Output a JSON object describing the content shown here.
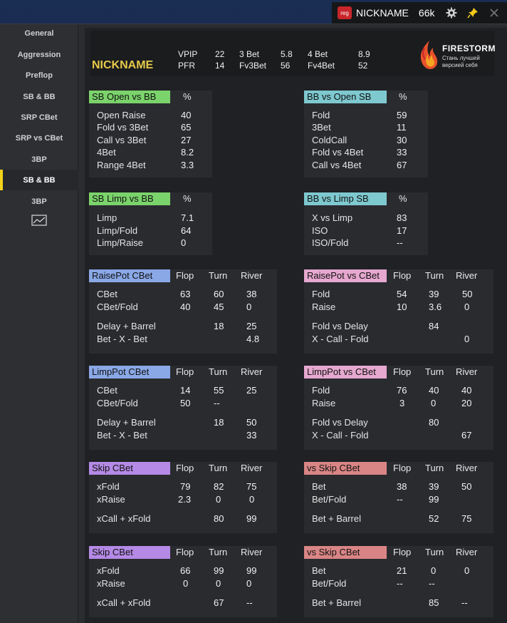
{
  "titlebar": {
    "logo_text": "reg",
    "nickname": "NICKNAME",
    "hands": "66k",
    "icons": [
      "gear-icon",
      "pin-icon",
      "close-icon"
    ]
  },
  "sidebar": {
    "items": [
      {
        "label": "General"
      },
      {
        "label": "Aggression"
      },
      {
        "label": "Preflop"
      },
      {
        "label": "SB & BB"
      },
      {
        "label": "SRP CBet"
      },
      {
        "label": "SRP vs CBet"
      },
      {
        "label": "3BP"
      },
      {
        "label": "SB & BB",
        "active": true
      },
      {
        "label": "3BP"
      }
    ],
    "chart_icon": "chart-icon"
  },
  "header": {
    "nickname": "NICKNAME",
    "stats": [
      {
        "label": "VPIP",
        "value": "22"
      },
      {
        "label": "PFR",
        "value": "14"
      },
      {
        "label": "3 Bet",
        "value": "5.8"
      },
      {
        "label": "Fv3Bet",
        "value": "56"
      },
      {
        "label": "4 Bet",
        "value": "8.9"
      },
      {
        "label": "Fv4Bet",
        "value": "52"
      }
    ],
    "brand_name": "FIRESTORM",
    "brand_tagline": "Стань лучшей версией себя"
  },
  "colors": {
    "green": "#7bd36b",
    "teal": "#7ec8cf",
    "blue": "#8aa8e6",
    "pink": "#e6a8cf",
    "purple": "#b58ae6",
    "red": "#d98585",
    "gold": "#e6c94a"
  },
  "panels": {
    "sb_open": {
      "title": "SB Open vs BB",
      "cols": [
        "%"
      ],
      "rows": [
        {
          "label": "Open Raise",
          "values": [
            "40"
          ]
        },
        {
          "label": "Fold vs 3Bet",
          "values": [
            "65"
          ]
        },
        {
          "label": "Call vs 3Bet",
          "values": [
            "27"
          ]
        },
        {
          "label": "4Bet",
          "values": [
            "8.2"
          ]
        },
        {
          "label": "Range 4Bet",
          "values": [
            "3.3"
          ]
        }
      ]
    },
    "bb_open": {
      "title": "BB vs Open SB",
      "cols": [
        "%"
      ],
      "rows": [
        {
          "label": "Fold",
          "values": [
            "59"
          ]
        },
        {
          "label": "3Bet",
          "values": [
            "11"
          ]
        },
        {
          "label": "ColdCall",
          "values": [
            "30"
          ]
        },
        {
          "label": "Fold vs 4Bet",
          "values": [
            "33"
          ]
        },
        {
          "label": "Call vs 4Bet",
          "values": [
            "67"
          ]
        }
      ]
    },
    "sb_limp": {
      "title": "SB Limp vs BB",
      "cols": [
        "%"
      ],
      "rows": [
        {
          "label": "Limp",
          "values": [
            "7.1"
          ]
        },
        {
          "label": "Limp/Fold",
          "values": [
            "64"
          ]
        },
        {
          "label": "Limp/Raise",
          "values": [
            "0"
          ]
        }
      ]
    },
    "bb_limp": {
      "title": "BB vs Limp SB",
      "cols": [
        "%"
      ],
      "rows": [
        {
          "label": "X vs Limp",
          "values": [
            "83"
          ]
        },
        {
          "label": "ISO",
          "values": [
            "17"
          ]
        },
        {
          "label": "ISO/Fold",
          "values": [
            "--"
          ]
        }
      ]
    },
    "raise_cbet": {
      "title": "RaisePot CBet",
      "cols": [
        "Flop",
        "Turn",
        "River"
      ],
      "rows": [
        {
          "label": "CBet",
          "values": [
            "63",
            "60",
            "38"
          ]
        },
        {
          "label": "CBet/Fold",
          "values": [
            "40",
            "45",
            "0"
          ]
        },
        {
          "label": "Delay + Barrel",
          "values": [
            "",
            "18",
            "25"
          ]
        },
        {
          "label": "Bet - X - Bet",
          "values": [
            "",
            "",
            "4.8"
          ]
        }
      ]
    },
    "raise_vs_cbet": {
      "title": "RaisePot vs CBet",
      "cols": [
        "Flop",
        "Turn",
        "River"
      ],
      "rows": [
        {
          "label": "Fold",
          "values": [
            "54",
            "39",
            "50"
          ]
        },
        {
          "label": "Raise",
          "values": [
            "10",
            "3.6",
            "0"
          ]
        },
        {
          "label": "Fold vs Delay",
          "values": [
            "",
            "84",
            ""
          ]
        },
        {
          "label": "X - Call - Fold",
          "values": [
            "",
            "",
            "0"
          ]
        }
      ]
    },
    "limp_cbet": {
      "title": "LimpPot CBet",
      "cols": [
        "Flop",
        "Turn",
        "River"
      ],
      "rows": [
        {
          "label": "CBet",
          "values": [
            "14",
            "55",
            "25"
          ]
        },
        {
          "label": "CBet/Fold",
          "values": [
            "50",
            "--",
            ""
          ]
        },
        {
          "label": "Delay + Barrel",
          "values": [
            "",
            "18",
            "50"
          ]
        },
        {
          "label": "Bet - X - Bet",
          "values": [
            "",
            "",
            "33"
          ]
        }
      ]
    },
    "limp_vs_cbet": {
      "title": "LimpPot vs CBet",
      "cols": [
        "Flop",
        "Turn",
        "River"
      ],
      "rows": [
        {
          "label": "Fold",
          "values": [
            "76",
            "40",
            "40"
          ]
        },
        {
          "label": "Raise",
          "values": [
            "3",
            "0",
            "20"
          ]
        },
        {
          "label": "Fold vs Delay",
          "values": [
            "",
            "80",
            ""
          ]
        },
        {
          "label": "X - Call - Fold",
          "values": [
            "",
            "",
            "67"
          ]
        }
      ]
    },
    "skip_cbet_1": {
      "title": "Skip CBet",
      "cols": [
        "Flop",
        "Turn",
        "River"
      ],
      "rows": [
        {
          "label": "xFold",
          "values": [
            "79",
            "82",
            "75"
          ]
        },
        {
          "label": "xRaise",
          "values": [
            "2.3",
            "0",
            "0"
          ]
        },
        {
          "label": "xCall + xFold",
          "values": [
            "",
            "80",
            "99"
          ]
        }
      ]
    },
    "vs_skip_1": {
      "title": "vs Skip CBet",
      "cols": [
        "Flop",
        "Turn",
        "River"
      ],
      "rows": [
        {
          "label": "Bet",
          "values": [
            "38",
            "39",
            "50"
          ]
        },
        {
          "label": "Bet/Fold",
          "values": [
            "--",
            "99",
            ""
          ]
        },
        {
          "label": "Bet + Barrel",
          "values": [
            "",
            "52",
            "75"
          ]
        }
      ]
    },
    "skip_cbet_2": {
      "title": "Skip CBet",
      "cols": [
        "Flop",
        "Turn",
        "River"
      ],
      "rows": [
        {
          "label": "xFold",
          "values": [
            "66",
            "99",
            "99"
          ]
        },
        {
          "label": "xRaise",
          "values": [
            "0",
            "0",
            "0"
          ]
        },
        {
          "label": "xCall + xFold",
          "values": [
            "",
            "67",
            "--"
          ]
        }
      ]
    },
    "vs_skip_2": {
      "title": "vs Skip CBet",
      "cols": [
        "Flop",
        "Turn",
        "River"
      ],
      "rows": [
        {
          "label": "Bet",
          "values": [
            "21",
            "0",
            "0"
          ]
        },
        {
          "label": "Bet/Fold",
          "values": [
            "--",
            "--",
            ""
          ]
        },
        {
          "label": "Bet + Barrel",
          "values": [
            "",
            "85",
            "--"
          ]
        }
      ]
    }
  }
}
